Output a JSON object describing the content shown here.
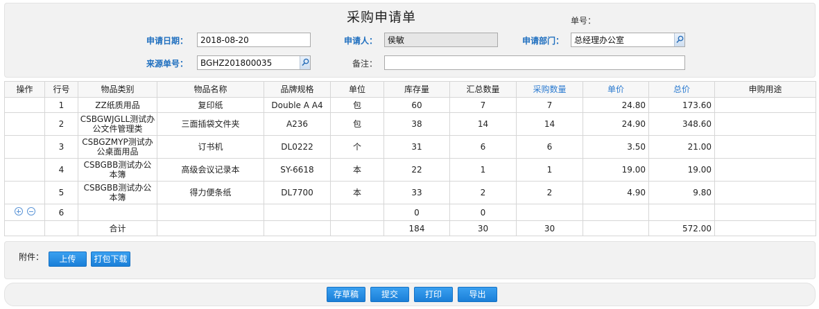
{
  "title": "采购申请单",
  "form": {
    "order_no_label": "单号：",
    "date_label": "申请日期：",
    "date_value": "2018-08-20",
    "applicant_label": "申请人：",
    "applicant_value": "侯敏",
    "dept_label": "申请部门：",
    "dept_value": "总经理办公室",
    "source_label": "来源单号：",
    "source_value": "BGHZ201800035",
    "remark_label": "备注：",
    "remark_value": ""
  },
  "table": {
    "headers": [
      "操作",
      "行号",
      "物品类别",
      "物品名称",
      "品牌规格",
      "单位",
      "库存量",
      "汇总数量",
      "采购数量",
      "单价",
      "总价",
      "申购用途"
    ],
    "rows": [
      {
        "line": "1",
        "category": "ZZ纸质用品",
        "name": "复印纸",
        "spec": "Double A A4",
        "unit": "包",
        "stock": "60",
        "summary": "7",
        "purchase": "7",
        "price": "24.80",
        "total": "173.60",
        "purpose": ""
      },
      {
        "line": "2",
        "category": "CSBGWJGLL测试办公文件管理类",
        "name": "三面插袋文件夹",
        "spec": "A236",
        "unit": "包",
        "stock": "38",
        "summary": "14",
        "purchase": "14",
        "price": "24.90",
        "total": "348.60",
        "purpose": ""
      },
      {
        "line": "3",
        "category": "CSBGZMYP测试办公桌面用品",
        "name": "订书机",
        "spec": "DL0222",
        "unit": "个",
        "stock": "31",
        "summary": "6",
        "purchase": "6",
        "price": "3.50",
        "total": "21.00",
        "purpose": ""
      },
      {
        "line": "4",
        "category": "CSBGBB测试办公本簿",
        "name": "高级会议记录本",
        "spec": "SY-6618",
        "unit": "本",
        "stock": "22",
        "summary": "1",
        "purchase": "1",
        "price": "19.00",
        "total": "19.00",
        "purpose": ""
      },
      {
        "line": "5",
        "category": "CSBGBB测试办公本簿",
        "name": "得力便条纸",
        "spec": "DL7700",
        "unit": "本",
        "stock": "33",
        "summary": "2",
        "purchase": "2",
        "price": "4.90",
        "total": "9.80",
        "purpose": ""
      },
      {
        "line": "6",
        "category": "",
        "name": "",
        "spec": "",
        "unit": "",
        "stock": "0",
        "summary": "0",
        "purchase": "",
        "price": "",
        "total": "",
        "purpose": ""
      }
    ],
    "totals": {
      "label": "合计",
      "stock": "184",
      "summary": "30",
      "purchase": "30",
      "total": "572.00"
    }
  },
  "attachments": {
    "label": "附件：",
    "upload_label": "上传",
    "download_label": "打包下载"
  },
  "footer": {
    "save_draft": "存草稿",
    "submit": "提交",
    "print": "打印",
    "export": "导出"
  },
  "colors": {
    "label_blue": "#1f6fbf",
    "button_blue": "#1a7fd8",
    "header_blue": "#2a7ad0"
  },
  "icons": {
    "lookup": "magnifier-icon",
    "add_row": "plus-circle-icon",
    "remove_row": "minus-circle-icon"
  }
}
